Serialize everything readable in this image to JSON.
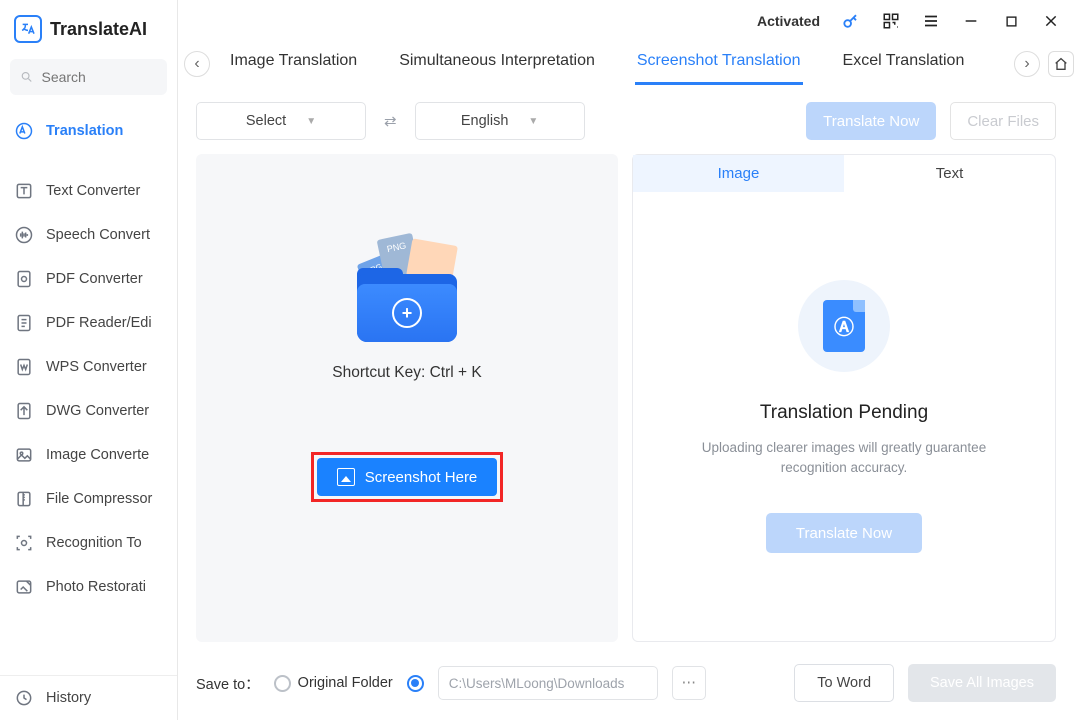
{
  "app": {
    "name": "TranslateAI",
    "status": "Activated"
  },
  "search": {
    "placeholder": "Search"
  },
  "nav": {
    "items": [
      {
        "label": "Translation"
      },
      {
        "label": "Text Converter"
      },
      {
        "label": "Speech Convert"
      },
      {
        "label": "PDF Converter"
      },
      {
        "label": "PDF Reader/Edi"
      },
      {
        "label": "WPS Converter"
      },
      {
        "label": "DWG Converter"
      },
      {
        "label": "Image Converte"
      },
      {
        "label": "File Compressor"
      },
      {
        "label": "Recognition To"
      },
      {
        "label": "Photo Restorati"
      }
    ],
    "history": "History"
  },
  "tabs": [
    "Image Translation",
    "Simultaneous Interpretation",
    "Screenshot Translation",
    "Excel Translation"
  ],
  "lang": {
    "source": "Select",
    "target": "English"
  },
  "toolbar": {
    "translate": "Translate Now",
    "clear": "Clear Files"
  },
  "left_panel": {
    "shortcut": "Shortcut Key: Ctrl + K",
    "button": "Screenshot Here"
  },
  "right_panel": {
    "tabs": [
      "Image",
      "Text"
    ],
    "title": "Translation Pending",
    "desc": "Uploading clearer images will greatly guarantee recognition accuracy.",
    "button": "Translate Now"
  },
  "footer": {
    "save_to": "Save to：",
    "original": "Original Folder",
    "path": "C:\\Users\\MLoong\\Downloads",
    "to_word": "To Word",
    "save_all": "Save All Images"
  }
}
